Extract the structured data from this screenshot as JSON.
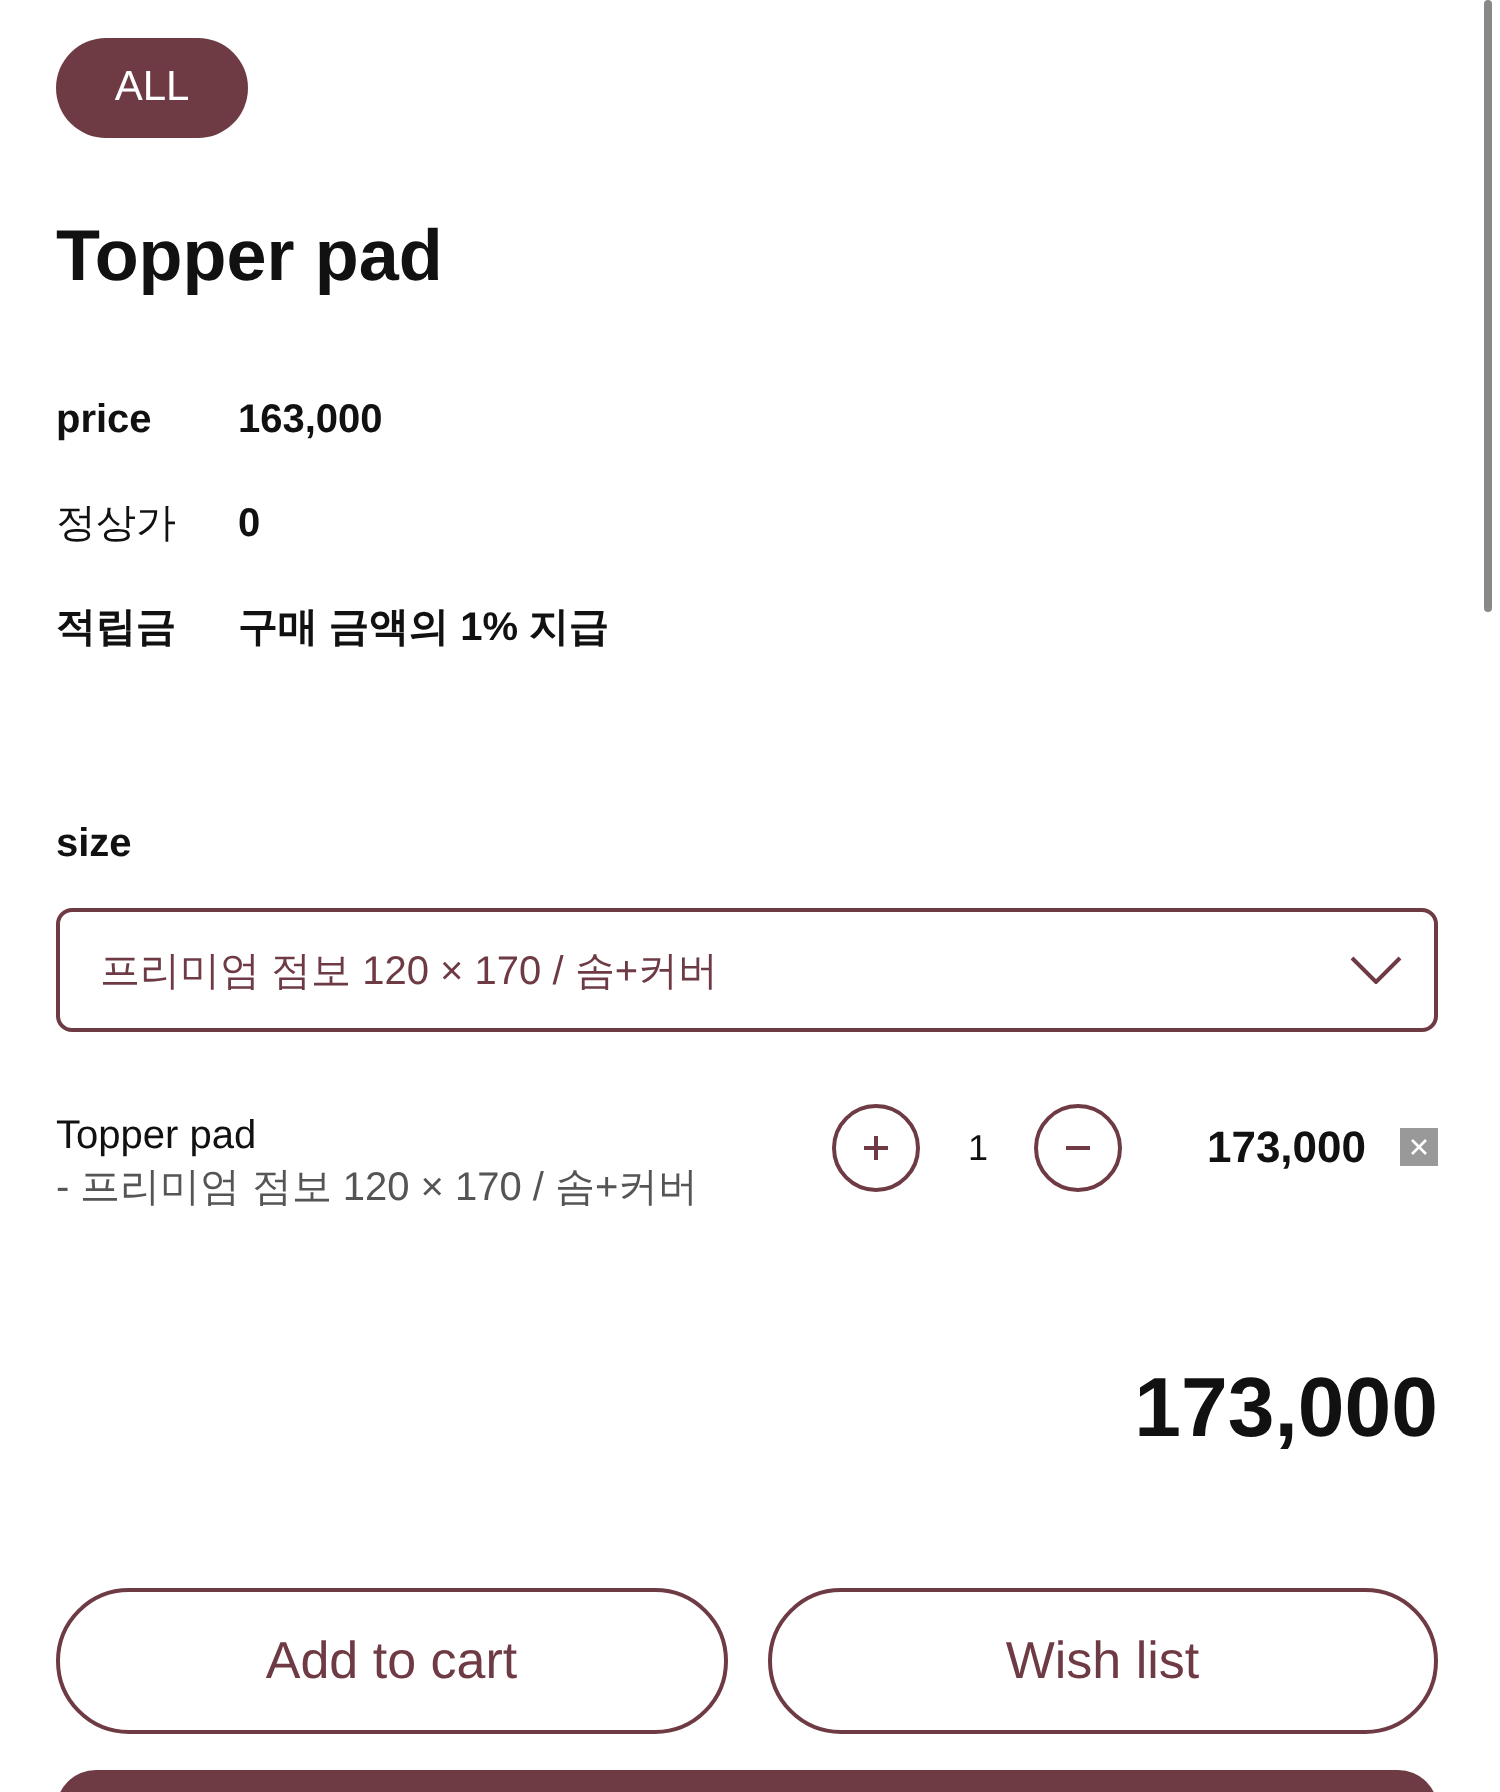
{
  "badge": "ALL",
  "title": "Topper pad",
  "info": [
    {
      "label": "price",
      "value": "163,000",
      "kind": "bold"
    },
    {
      "label": "정상가",
      "value": "0",
      "kind": "plain"
    },
    {
      "label": "적립금",
      "value": "구매 금액의 1% 지급",
      "kind": "bold"
    }
  ],
  "option": {
    "label": "size",
    "value": "프리미엄 점보 120 × 170 / 솜+커버"
  },
  "item": {
    "name": "Topper pad",
    "option": "- 프리미엄 점보 120 × 170 / 솜+커버",
    "quantity": "1",
    "price": "173,000"
  },
  "total": "173,000",
  "buttons": [
    "Add to cart",
    "Wish list"
  ]
}
